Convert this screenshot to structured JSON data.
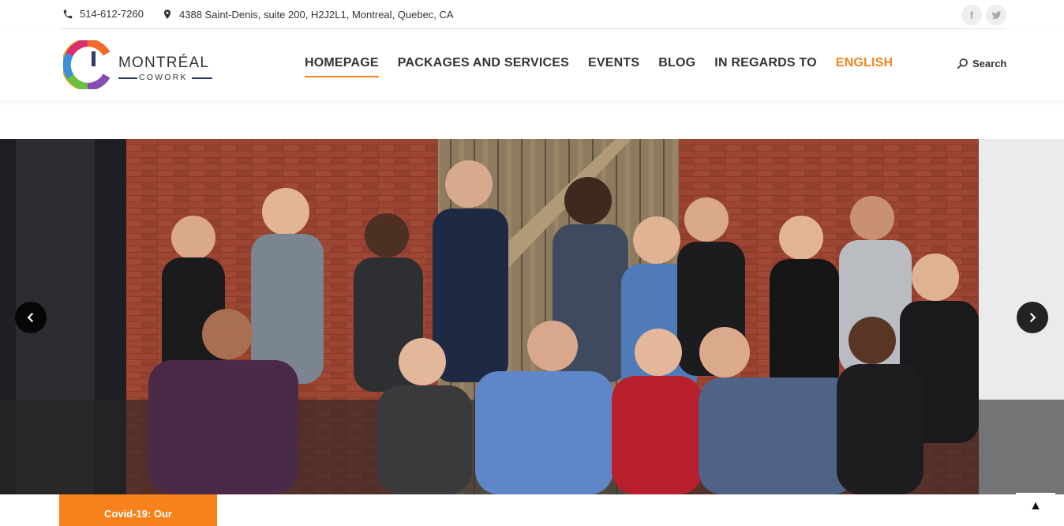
{
  "topbar": {
    "phone": "514-612-7260",
    "address": "4388 Saint-Denis, suite 200, H2J2L1, Montreal, Quebec, CA",
    "social": {
      "facebook": "f"
    }
  },
  "logo": {
    "title": "MONTRÉAL",
    "subtitle": "COWORK"
  },
  "nav": {
    "items": [
      "HOMEPAGE",
      "PACKAGES AND SERVICES",
      "EVENTS",
      "BLOG",
      "IN REGARDS TO"
    ],
    "language": "ENGLISH"
  },
  "search": {
    "label": "Search"
  },
  "banner": {
    "covid_label": "Covid-19: Our"
  },
  "back_to_top": "▲",
  "colors": {
    "accent": "#f7821b",
    "text": "#333333",
    "navy": "#2d3e6b"
  },
  "icons": [
    "phone-icon",
    "location-pin-icon",
    "facebook-icon",
    "twitter-icon",
    "search-icon",
    "chevron-left-icon",
    "chevron-right-icon",
    "arrow-up-icon"
  ]
}
